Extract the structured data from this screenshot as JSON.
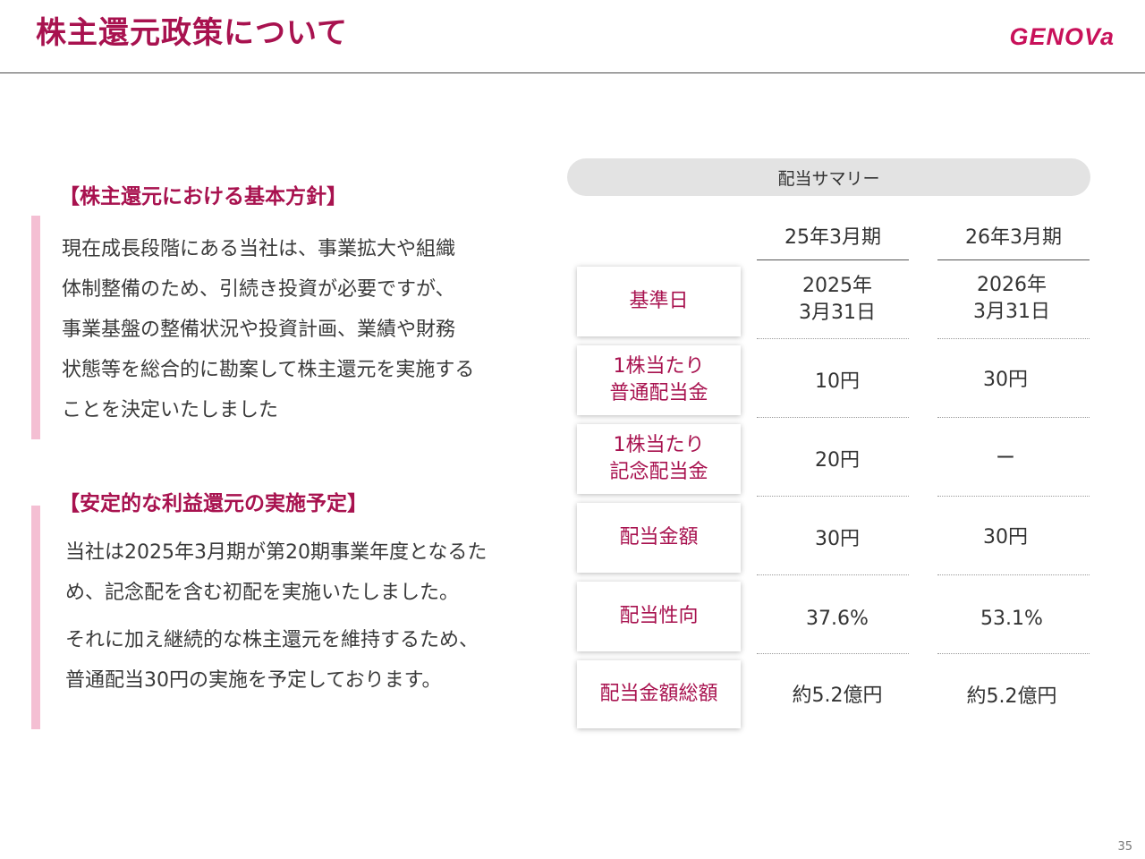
{
  "header": {
    "title": "株主還元政策について",
    "logo": "GENOVa"
  },
  "section1": {
    "heading": "【株主還元における基本方針】",
    "lines": [
      "現在成長段階にある当社は、事業拡大や組織",
      "体制整備のため、引続き投資が必要ですが、",
      "事業基盤の整備状況や投資計画、業績や財務",
      "状態等を総合的に勘案して株主還元を実施する",
      "ことを決定いたしました"
    ]
  },
  "section2": {
    "heading": "【安定的な利益還元の実施予定】",
    "lines": [
      "当社は2025年3月期が第20期事業年度となるた",
      "め、記念配を含む初配を実施いたしました。",
      "それに加え継続的な株主還元を維持するため、",
      "普通配当30円の実施を予定しております。"
    ]
  },
  "summary": {
    "title": "配当サマリー",
    "columns": [
      "25年3月期",
      "26年3月期"
    ],
    "rows": [
      {
        "label": [
          "基準日"
        ],
        "fy25": [
          "2025年",
          "3月31日"
        ],
        "fy26": [
          "2026年",
          "3月31日"
        ]
      },
      {
        "label": [
          "1株当たり",
          "普通配当金"
        ],
        "fy25": [
          "10円"
        ],
        "fy26": [
          "30円"
        ]
      },
      {
        "label": [
          "1株当たり",
          "記念配当金"
        ],
        "fy25": [
          "20円"
        ],
        "fy26": [
          "ー"
        ]
      },
      {
        "label": [
          "配当金額"
        ],
        "fy25": [
          "30円"
        ],
        "fy26": [
          "30円"
        ]
      },
      {
        "label": [
          "配当性向"
        ],
        "fy25": [
          "37.6%"
        ],
        "fy26": [
          "53.1%"
        ]
      },
      {
        "label": [
          "配当金額総額"
        ],
        "fy25": [
          "約5.2億円"
        ],
        "fy26": [
          "約5.2億円"
        ]
      }
    ]
  },
  "page_number": "35"
}
